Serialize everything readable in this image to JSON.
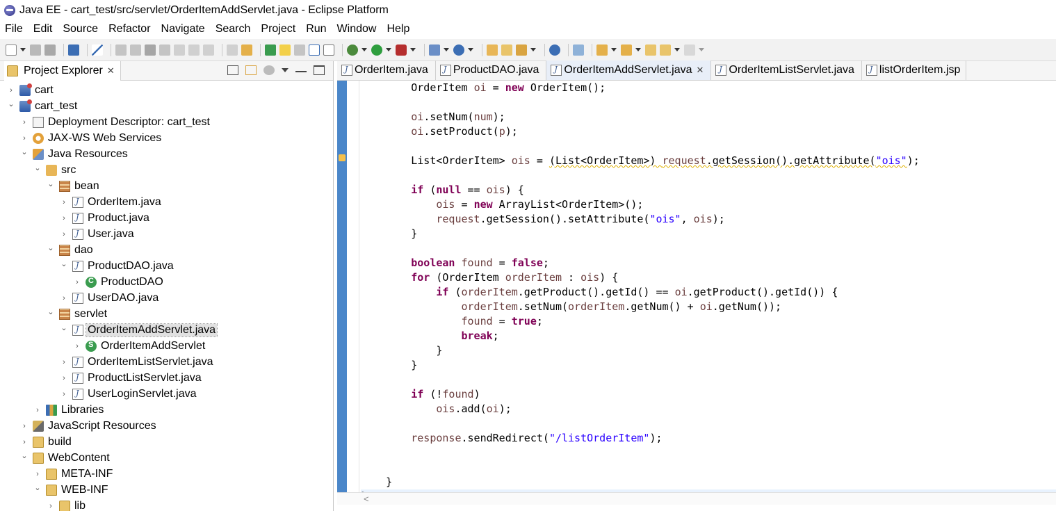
{
  "window": {
    "title": "Java EE - cart_test/src/servlet/OrderItemAddServlet.java - Eclipse Platform"
  },
  "menu": [
    "File",
    "Edit",
    "Source",
    "Refactor",
    "Navigate",
    "Search",
    "Project",
    "Run",
    "Window",
    "Help"
  ],
  "explorer": {
    "tab_label": "Project Explorer",
    "tree": [
      {
        "label": "cart",
        "depth": 0,
        "icon": "project-icon",
        "expanded": false
      },
      {
        "label": "cart_test",
        "depth": 0,
        "icon": "project-icon",
        "expanded": true
      },
      {
        "label": "Deployment Descriptor: cart_test",
        "depth": 1,
        "icon": "descriptor-icon",
        "expanded": false
      },
      {
        "label": "JAX-WS Web Services",
        "depth": 1,
        "icon": "services-icon",
        "expanded": false
      },
      {
        "label": "Java Resources",
        "depth": 1,
        "icon": "resources-icon",
        "expanded": true
      },
      {
        "label": "src",
        "depth": 2,
        "icon": "source-folder-icon",
        "expanded": true
      },
      {
        "label": "bean",
        "depth": 3,
        "icon": "package-icon",
        "expanded": true
      },
      {
        "label": "OrderItem.java",
        "depth": 4,
        "icon": "java-file-icon",
        "expanded": false
      },
      {
        "label": "Product.java",
        "depth": 4,
        "icon": "java-file-icon",
        "expanded": false
      },
      {
        "label": "User.java",
        "depth": 4,
        "icon": "java-file-icon",
        "expanded": false
      },
      {
        "label": "dao",
        "depth": 3,
        "icon": "package-icon",
        "expanded": true
      },
      {
        "label": "ProductDAO.java",
        "depth": 4,
        "icon": "java-file-icon",
        "expanded": true
      },
      {
        "label": "ProductDAO",
        "depth": 5,
        "icon": "class-icon",
        "expanded": false
      },
      {
        "label": "UserDAO.java",
        "depth": 4,
        "icon": "java-file-icon",
        "expanded": false
      },
      {
        "label": "servlet",
        "depth": 3,
        "icon": "package-icon",
        "expanded": true
      },
      {
        "label": "OrderItemAddServlet.java",
        "depth": 4,
        "icon": "java-file-icon",
        "expanded": true,
        "selected": true
      },
      {
        "label": "OrderItemAddServlet",
        "depth": 5,
        "icon": "servlet-class-icon",
        "expanded": false
      },
      {
        "label": "OrderItemListServlet.java",
        "depth": 4,
        "icon": "java-file-icon",
        "expanded": false
      },
      {
        "label": "ProductListServlet.java",
        "depth": 4,
        "icon": "java-file-icon",
        "expanded": false
      },
      {
        "label": "UserLoginServlet.java",
        "depth": 4,
        "icon": "java-file-icon",
        "expanded": false
      },
      {
        "label": "Libraries",
        "depth": 2,
        "icon": "libraries-icon",
        "expanded": false
      },
      {
        "label": "JavaScript Resources",
        "depth": 1,
        "icon": "js-resources-icon",
        "expanded": false
      },
      {
        "label": "build",
        "depth": 1,
        "icon": "folder-icon",
        "expanded": false
      },
      {
        "label": "WebContent",
        "depth": 1,
        "icon": "folder-icon",
        "expanded": true
      },
      {
        "label": "META-INF",
        "depth": 2,
        "icon": "folder-icon",
        "expanded": false
      },
      {
        "label": "WEB-INF",
        "depth": 2,
        "icon": "folder-icon",
        "expanded": true
      },
      {
        "label": "lib",
        "depth": 3,
        "icon": "folder-icon",
        "expanded": false
      }
    ]
  },
  "editor": {
    "tabs": [
      {
        "label": "OrderItem.java",
        "active": false
      },
      {
        "label": "ProductDAO.java",
        "active": false
      },
      {
        "label": "OrderItemAddServlet.java",
        "active": true
      },
      {
        "label": "OrderItemListServlet.java",
        "active": false
      },
      {
        "label": "listOrderItem.jsp",
        "active": false
      }
    ],
    "code_lines": [
      [
        [
          "        ",
          ""
        ],
        [
          "OrderItem ",
          ""
        ],
        [
          "oi",
          "var"
        ],
        [
          " = ",
          ""
        ],
        [
          "new",
          "kw"
        ],
        [
          " OrderItem();",
          ""
        ]
      ],
      [],
      [
        [
          "        ",
          ""
        ],
        [
          "oi",
          "var"
        ],
        [
          ".setNum(",
          ""
        ],
        [
          "num",
          "var"
        ],
        [
          ");",
          ""
        ]
      ],
      [
        [
          "        ",
          ""
        ],
        [
          "oi",
          "var"
        ],
        [
          ".setProduct(",
          ""
        ],
        [
          "p",
          "var"
        ],
        [
          ");",
          ""
        ]
      ],
      [],
      [
        [
          "        ",
          ""
        ],
        [
          "List<OrderItem> ",
          ""
        ],
        [
          "ois",
          "var"
        ],
        [
          " = ",
          ""
        ],
        [
          "(List<OrderItem>) ",
          "warn"
        ],
        [
          "request",
          "warnvar"
        ],
        [
          ".getSession().getAttribute(",
          "warn"
        ],
        [
          "\"ois\"",
          "warnstr"
        ],
        [
          ");",
          ""
        ]
      ],
      [],
      [
        [
          "        ",
          ""
        ],
        [
          "if",
          "kw"
        ],
        [
          " (",
          ""
        ],
        [
          "null",
          "kw"
        ],
        [
          " == ",
          ""
        ],
        [
          "ois",
          "var"
        ],
        [
          ") {",
          ""
        ]
      ],
      [
        [
          "            ",
          ""
        ],
        [
          "ois",
          "var"
        ],
        [
          " = ",
          ""
        ],
        [
          "new",
          "kw"
        ],
        [
          " ArrayList<OrderItem>();",
          ""
        ]
      ],
      [
        [
          "            ",
          ""
        ],
        [
          "request",
          "var"
        ],
        [
          ".getSession().setAttribute(",
          ""
        ],
        [
          "\"ois\"",
          "str"
        ],
        [
          ", ",
          ""
        ],
        [
          "ois",
          "var"
        ],
        [
          ");",
          ""
        ]
      ],
      [
        [
          "        }",
          ""
        ]
      ],
      [],
      [
        [
          "        ",
          ""
        ],
        [
          "boolean",
          "kw"
        ],
        [
          " ",
          ""
        ],
        [
          "found",
          "var"
        ],
        [
          " = ",
          ""
        ],
        [
          "false",
          "kw"
        ],
        [
          ";",
          ""
        ]
      ],
      [
        [
          "        ",
          ""
        ],
        [
          "for",
          "kw"
        ],
        [
          " (OrderItem ",
          ""
        ],
        [
          "orderItem",
          "var"
        ],
        [
          " : ",
          ""
        ],
        [
          "ois",
          "var"
        ],
        [
          ") {",
          ""
        ]
      ],
      [
        [
          "            ",
          ""
        ],
        [
          "if",
          "kw"
        ],
        [
          " (",
          ""
        ],
        [
          "orderItem",
          "var"
        ],
        [
          ".getProduct().getId() == ",
          ""
        ],
        [
          "oi",
          "var"
        ],
        [
          ".getProduct().getId()) {",
          ""
        ]
      ],
      [
        [
          "                ",
          ""
        ],
        [
          "orderItem",
          "var"
        ],
        [
          ".setNum(",
          ""
        ],
        [
          "orderItem",
          "var"
        ],
        [
          ".getNum() + ",
          ""
        ],
        [
          "oi",
          "var"
        ],
        [
          ".getNum());",
          ""
        ]
      ],
      [
        [
          "                ",
          ""
        ],
        [
          "found",
          "var"
        ],
        [
          " = ",
          ""
        ],
        [
          "true",
          "kw"
        ],
        [
          ";",
          ""
        ]
      ],
      [
        [
          "                ",
          ""
        ],
        [
          "break",
          "kw"
        ],
        [
          ";",
          ""
        ]
      ],
      [
        [
          "            }",
          ""
        ]
      ],
      [
        [
          "        }",
          ""
        ]
      ],
      [],
      [
        [
          "        ",
          ""
        ],
        [
          "if",
          "kw"
        ],
        [
          " (!",
          ""
        ],
        [
          "found",
          "var"
        ],
        [
          ")",
          ""
        ]
      ],
      [
        [
          "            ",
          ""
        ],
        [
          "ois",
          "var"
        ],
        [
          ".add(",
          ""
        ],
        [
          "oi",
          "var"
        ],
        [
          ");",
          ""
        ]
      ],
      [],
      [
        [
          "        ",
          ""
        ],
        [
          "response",
          "var"
        ],
        [
          ".sendRedirect(",
          ""
        ],
        [
          "\"/listOrderItem\"",
          "str"
        ],
        [
          ");",
          ""
        ]
      ],
      [],
      [],
      [
        [
          "    }",
          ""
        ]
      ],
      [
        [
          "}",
          ""
        ]
      ]
    ]
  },
  "colors": {
    "keyword": "#7f0055",
    "string": "#2a00ff",
    "variable": "#6a3e3e",
    "ruler": "#4a86c9",
    "current_line": "#e8f2fe"
  }
}
